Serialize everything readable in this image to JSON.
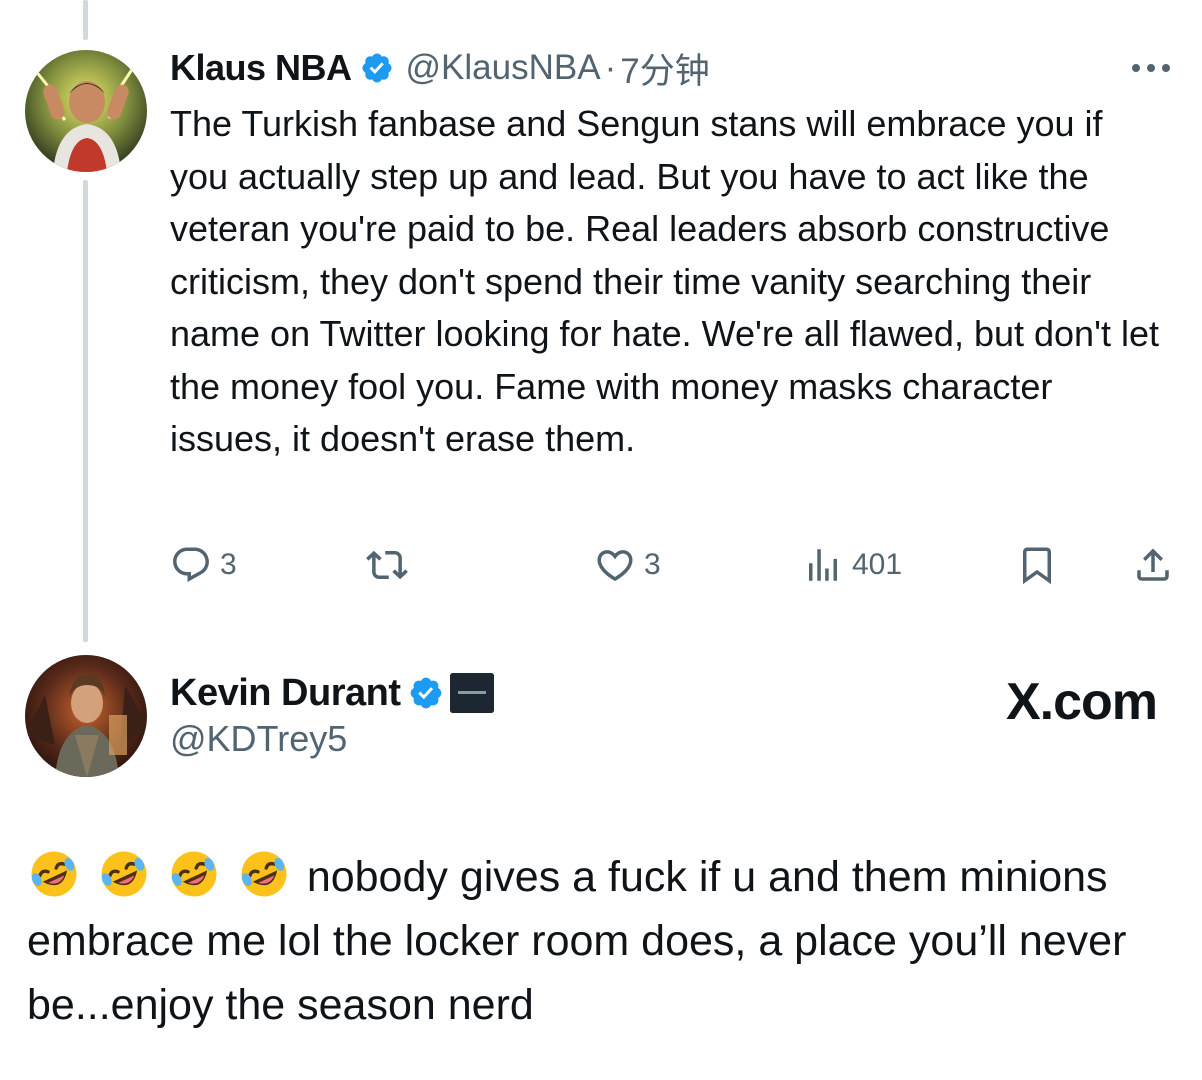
{
  "reply": {
    "display_name": "Klaus NBA",
    "handle": "@KlausNBA",
    "separator": "·",
    "time": "7分钟",
    "text": "The Turkish fanbase and Sengun stans will embrace you if you actually step up and lead. But you have to act like the veteran you're paid to be. Real leaders absorb constructive criticism, they don't spend their time vanity searching their name on Twitter looking for hate. We're all flawed, but don't let the money fool you. Fame with money masks character issues, it doesn't erase them.",
    "actions": {
      "reply_count": "3",
      "repost_count": "",
      "like_count": "3",
      "views_count": "401"
    }
  },
  "main": {
    "display_name": "Kevin Durant",
    "handle": "@KDTrey5",
    "text": "nobody gives a fuck if u and them minions embrace me lol the locker room does, a place you’ll never be...enjoy the season nerd",
    "emoji_count": 4
  },
  "watermark": "X.com",
  "icons": {
    "verified": "verified-badge-icon",
    "more": "more-horizontal-icon",
    "reply": "reply-icon",
    "repost": "repost-icon",
    "like": "heart-icon",
    "views": "views-bar-chart-icon",
    "bookmark": "bookmark-icon",
    "share": "share-icon",
    "emoji": "rolling-on-floor-laughing-emoji"
  },
  "colors": {
    "verified_blue": "#1d9bf0",
    "text_primary": "#0f1419",
    "text_secondary": "#536471",
    "thread_line": "#cfd9de"
  }
}
